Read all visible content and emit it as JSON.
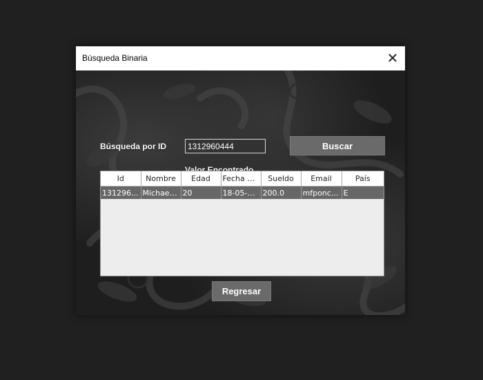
{
  "window": {
    "title": "Búsqueda Binaria",
    "close_symbol": "✕"
  },
  "search": {
    "label": "Búsqueda por ID",
    "value": "1312960444",
    "button_label": "Buscar"
  },
  "result_label": "Valor Encontrado",
  "table": {
    "columns": [
      "Id",
      "Nombre",
      "Edad",
      "Fecha d...",
      "Sueldo",
      "Email",
      "País"
    ],
    "rows": [
      [
        "131296...",
        "Michael ...",
        "20",
        "18-05-1...",
        "200.0",
        "mfponc...",
        "E"
      ]
    ]
  },
  "back_button_label": "Regresar",
  "colors": {
    "page_background": "#202020",
    "button": "#6a6a6a",
    "selected_row": "#676767"
  },
  "icons": [
    "close-icon"
  ]
}
